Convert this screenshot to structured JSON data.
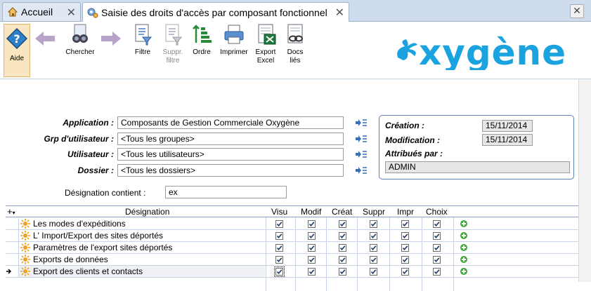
{
  "tabs": [
    {
      "label": "Accueil"
    },
    {
      "label": "Saisie des droits d'accès par composant fonctionnel"
    }
  ],
  "toolbar": {
    "aide": "Aide",
    "chercher": "Chercher",
    "filtre": "Filtre",
    "suppr_line1": "Suppr.",
    "suppr_line2": "filtre",
    "ordre": "Ordre",
    "imprimer": "Imprimer",
    "export_line1": "Export",
    "export_line2": "Excel",
    "docs_line1": "Docs",
    "docs_line2": "liés"
  },
  "brand": {
    "logo_text": "oxygène",
    "color": "#1aa3df"
  },
  "form": {
    "application_label": "Application :",
    "application_value": "Composants de Gestion Commerciale Oxygène",
    "grp_label": "Grp d'utilisateur :",
    "grp_value": "<Tous les groupes>",
    "utilisateur_label": "Utilisateur :",
    "utilisateur_value": "<Tous les utilisateurs>",
    "dossier_label": "Dossier :",
    "dossier_value": "<Tous les dossiers>",
    "designation_label": "Désignation contient :",
    "designation_value": "ex"
  },
  "info": {
    "creation_label": "Création :",
    "creation_value": "15/11/2014",
    "modification_label": "Modification :",
    "modification_value": "15/11/2014",
    "attribues_label": "Attribués par  :",
    "attribues_value": "ADMIN"
  },
  "grid": {
    "columns": [
      "Désignation",
      "Visu",
      "Modif",
      "Créat",
      "Suppr",
      "Impr",
      "Choix"
    ],
    "rows": [
      {
        "name": "Les modes d'expéditions",
        "selected": false
      },
      {
        "name": "L' Import/Export des sites déportés",
        "selected": false
      },
      {
        "name": "Paramètres de l'export sites déportés",
        "selected": false
      },
      {
        "name": "Exports de données",
        "selected": false
      },
      {
        "name": "Export des clients et contacts",
        "selected": true
      }
    ]
  }
}
